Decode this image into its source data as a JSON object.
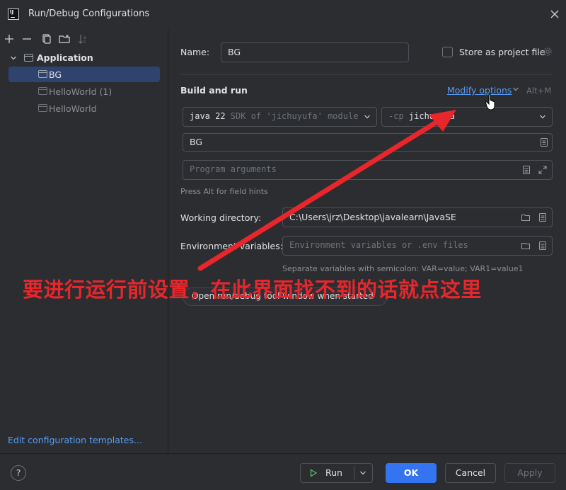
{
  "window": {
    "title": "Run/Debug Configurations"
  },
  "sidebar": {
    "tree": {
      "group": "Application",
      "items": [
        {
          "label": "BG",
          "selected": true
        },
        {
          "label": "HelloWorld (1)",
          "selected": false
        },
        {
          "label": "HelloWorld",
          "selected": false
        }
      ]
    },
    "edit_templates_link": "Edit configuration templates..."
  },
  "form": {
    "name_label": "Name:",
    "name_value": "BG",
    "store_checkbox_label": "Store as project file",
    "section_title": "Build and run",
    "modify_options": "Modify options",
    "modify_shortcut": "Alt+M",
    "sdk_combo": {
      "java": "java 22",
      "rest": " SDK of 'jichuyufa' module"
    },
    "cp_combo": {
      "flag": "-cp",
      "value": " jichuyufa"
    },
    "main_class_value": "BG",
    "program_args_placeholder": "Program arguments",
    "alt_hint": "Press Alt for field hints",
    "working_dir_label": "Working directory:",
    "working_dir_value": "C:\\Users\\jrz\\Desktop\\javalearn\\JavaSE",
    "env_label": "Environment variables:",
    "env_placeholder": "Environment variables or .env files",
    "env_hint": "Separate variables with semicolon: VAR=value; VAR1=value1",
    "open_tool_window_chip": "Open run/debug tool window when started"
  },
  "footer": {
    "run_label": "Run",
    "ok_label": "OK",
    "cancel_label": "Cancel",
    "apply_label": "Apply",
    "help_label": "?"
  },
  "annotation": {
    "text": "要进行运行前设置，在此界面找不到的话就点这里"
  },
  "colors": {
    "accent": "#3574f0",
    "link": "#589df6",
    "annotation_red": "#e8262c",
    "selection": "#2e436e"
  }
}
